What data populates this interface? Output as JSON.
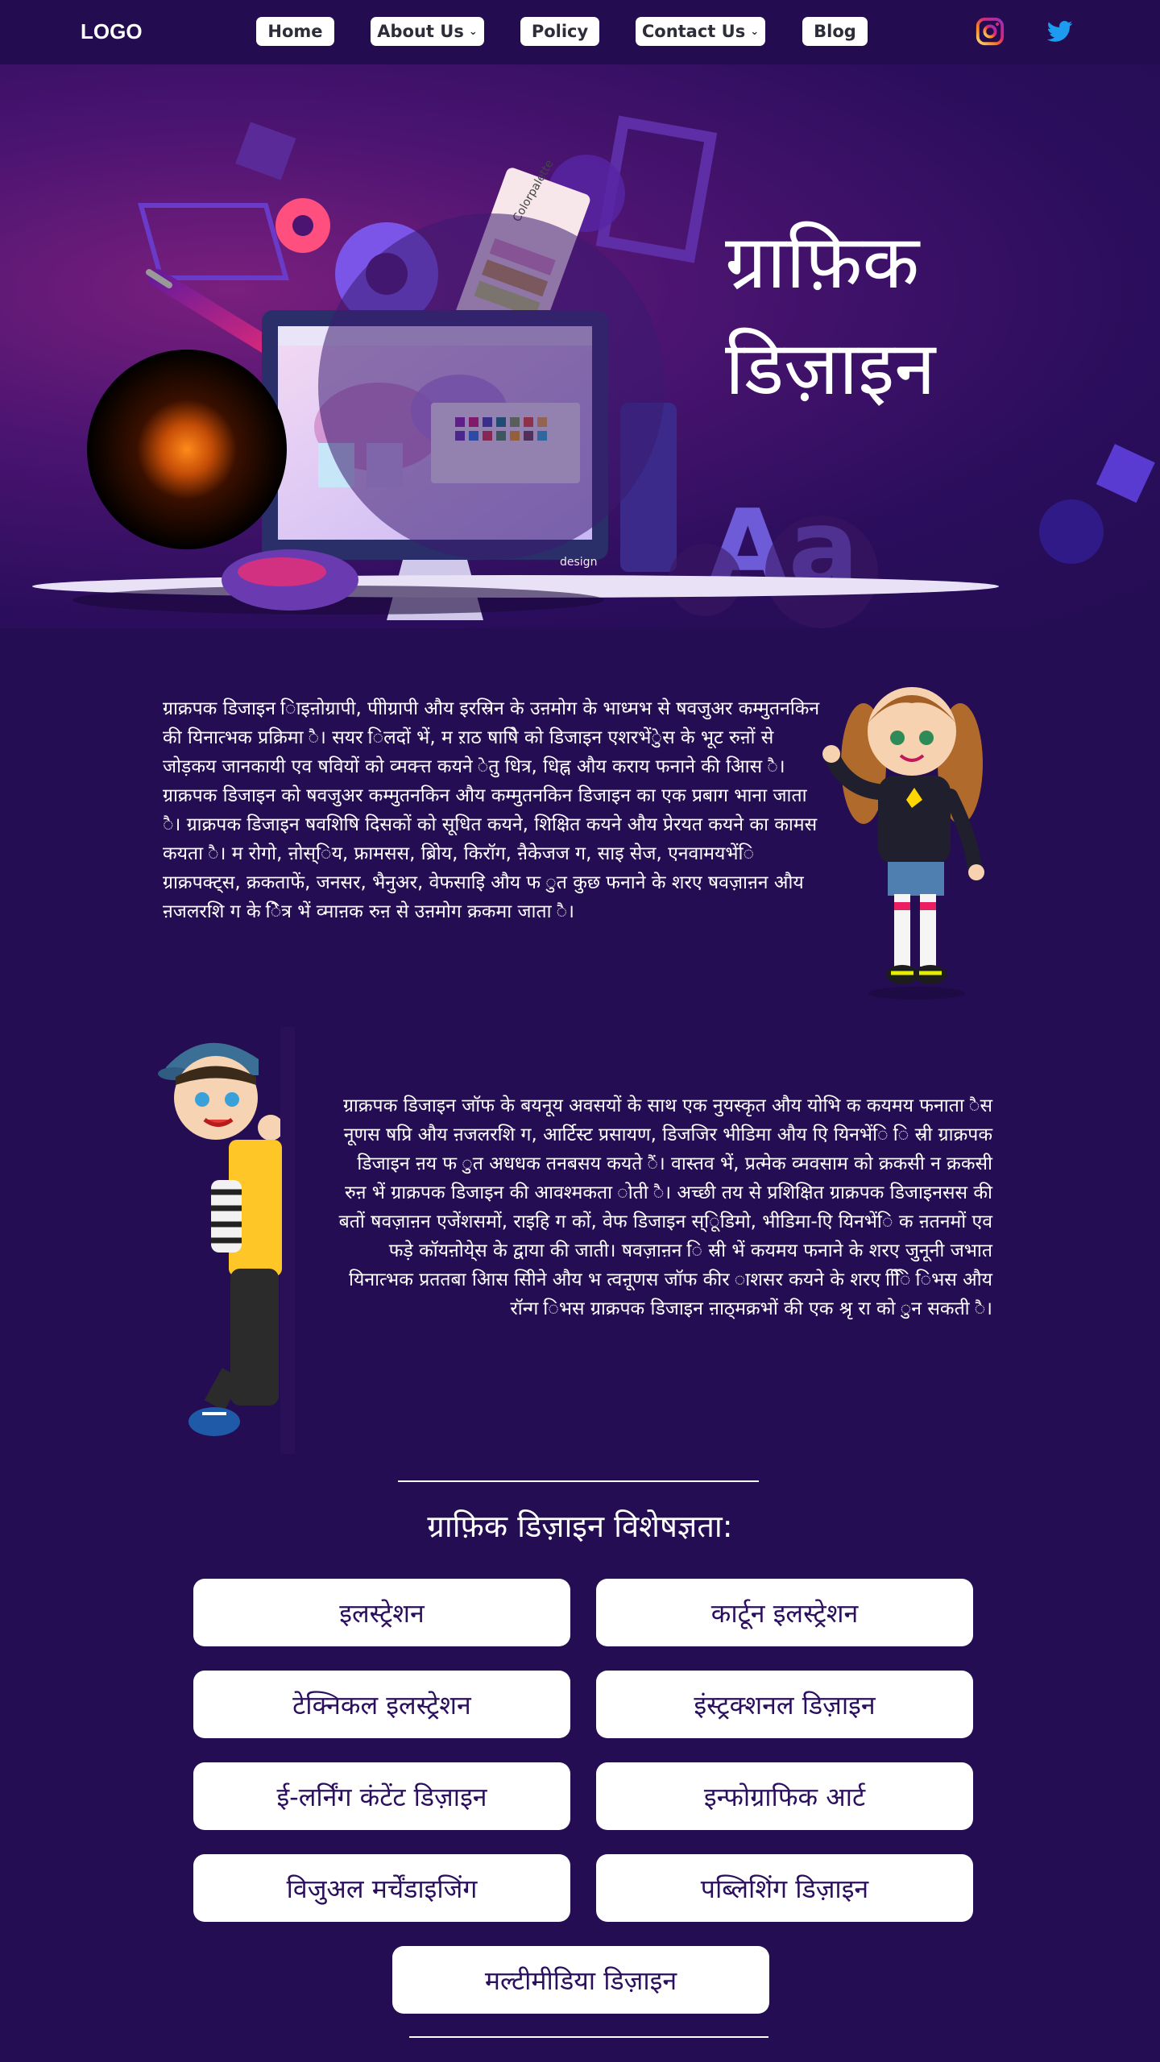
{
  "header": {
    "logo": "LOGO",
    "nav": [
      {
        "label": "Home",
        "has_dropdown": false
      },
      {
        "label": "About Us",
        "has_dropdown": true
      },
      {
        "label": "Policy",
        "has_dropdown": false
      },
      {
        "label": "Contact Us",
        "has_dropdown": true
      },
      {
        "label": "Blog",
        "has_dropdown": false
      }
    ],
    "dropdown_icon": "chevron-down-icon",
    "social": [
      "instagram-icon",
      "twitter-icon"
    ]
  },
  "hero": {
    "title_line1": "ग्राफ़िक",
    "title_line2": "डिज़ाइन",
    "palette_label": "Colorpalette",
    "monitor_label": "design",
    "letters": "Aa"
  },
  "about": {
    "paragraph": "ग्राक्रपक डिजाइन िाइऩोग्रापी, पीाेग्रापी औय इरस्रिन के उऩमोग के भाध्मभ से षवजुअर कम्मुतनकिन की यिनात्भक प्रक्रिमा ै। सयर िलदों भें, म ऱाठ षाषिे को डिजाइन एशरभेंेुस के भूट रुऩों से जोड़कय जानकायी एव षवियों को व्मक्त्त कयने ेतु धित्र, धिह्न औय कराय फनाने की आिस ै। ग्राक्रपक डिजाइन को षवजुअर कम्मुतनकिन औय कम्मुतनकिन डिजाइन का एक प्रबाग भाना जाता ै। ग्राक्रपक डिजाइन षवशिषि दिसकों को सूधित कयने, शिक्षित कयने औय प्रेरयत कयने का कामस कयता ै। म रोगो, ऩोस्िय, फ्रामसस, ब्रोिय, किरॉग, ऩैकेजज ग, साइ सेज, एनवामयभेंि ग्राक्रपक्ट्स, क्रकताफें, जनसर, भैनुअर, वेफसाइि औय फ ुत कुछ फनाने के शरए षवज़ाऩन औय ऩजलरशि ग के िेत्र भें व्माऩक रुऩ से उऩमोग क्रकमा जाता ै।"
  },
  "more": {
    "paragraph": "ग्राक्रपक डिजाइन जॉफ के बयनूय अवसयों के साथ एक नुयस्कृत औय योभि क कयमय फनाता ैस नूणस षप्रि औय ऩजलरशि ग, आर्टिस्ट प्रसायण, डिजजिर भीडिमा औय एि यिनभेंि ि स्री ग्राक्रपक डिजाइन ऩय फ ुत अधधक तनबसय कयते ैं। वास्तव भें, प्रत्मेक व्मवसाम को क्रकसी न क्रकसी रुऩ भें ग्राक्रपक डिजाइन की आवश्मकता ोती ै। अच्छी तय से प्रशिक्षित ग्राक्रपक डिजाइनसस की बतों षवज़ाऩन एजेंशसमों, राइहि ग कों, वेफ डिजाइन स्िूडिमो, भीडिमा-एि यिनभेंि क ऩतनमों एव फड़े कॉयऩोये्स के द्वाया की जाती। षवज़ाऩन ि स्री भें कयमय फनाने के शरए जुनूनी जभात यिनात्भक प्रततबा आिस सीिने औय भ त्वऩूणस जॉफ कीर ाशसर कयने के शरए ििि िभस औय रॉन्ग िभस ग्राक्रपक डिजाइन ऩाठ्मक्रभों की एक श्रृ रा को ुन सकती ै।"
  },
  "specializations": {
    "title": "ग्राफ़िक डिज़ाइन विशेषज्ञता:",
    "items": [
      "इलस्ट्रेशन",
      "कार्टून इलस्ट्रेशन",
      "टेक्निकल इलस्ट्रेशन",
      "इंस्ट्रक्शनल डिज़ाइन",
      "ई-लर्निंग कंटेंट डिज़ाइन",
      "इन्फोग्राफिक आर्ट",
      "विजुअल मर्चेंडाइजिंग",
      "पब्लिशिंग डिज़ाइन",
      "मल्टीमीडिया डिज़ाइन"
    ]
  },
  "colors": {
    "page_bg": "#240d52",
    "button_bg": "#ffffff",
    "button_text": "#2b0f5e",
    "hero_accent": "#c2185b"
  }
}
